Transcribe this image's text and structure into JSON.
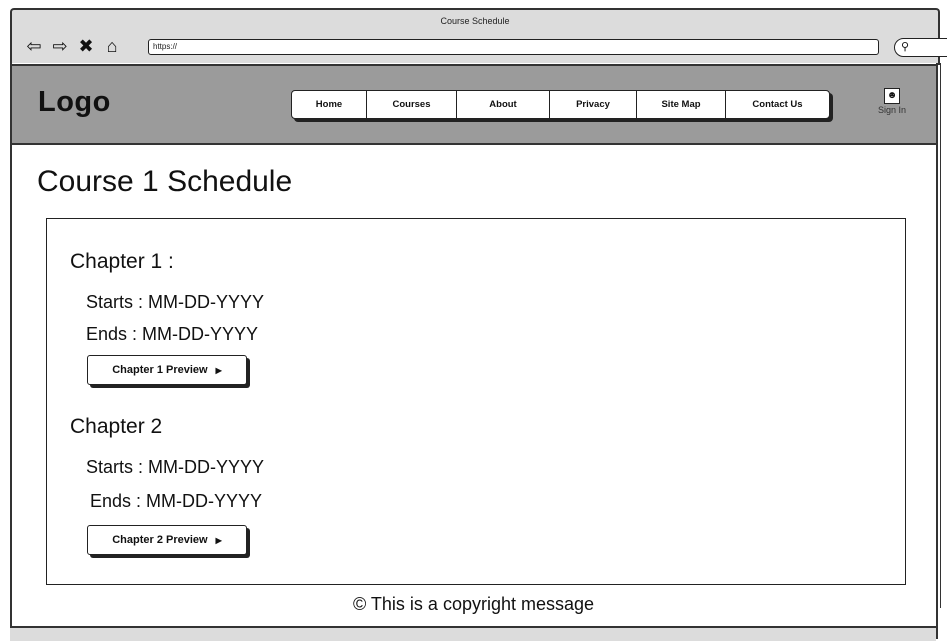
{
  "window": {
    "title": "Course Schedule"
  },
  "browser": {
    "url": "https://",
    "icons": [
      "back-arrow-icon",
      "forward-arrow-icon",
      "close-icon",
      "home-icon",
      "search-icon"
    ]
  },
  "header": {
    "logo": "Logo",
    "nav": [
      "Home",
      "Courses",
      "About",
      "Privacy",
      "Site Map",
      "Contact Us"
    ],
    "signin_label": "Sign In"
  },
  "main": {
    "title": "Course 1 Schedule",
    "chapters": [
      {
        "heading": "Chapter 1 :",
        "starts": "Starts : MM-DD-YYYY",
        "ends": "Ends : MM-DD-YYYY",
        "preview_label": "Chapter 1 Preview"
      },
      {
        "heading": "Chapter 2",
        "starts": "Starts : MM-DD-YYYY",
        "ends": "Ends : MM-DD-YYYY",
        "preview_label": "Chapter 2 Preview"
      }
    ]
  },
  "footer": {
    "copyright": "© This is a copyright message"
  }
}
